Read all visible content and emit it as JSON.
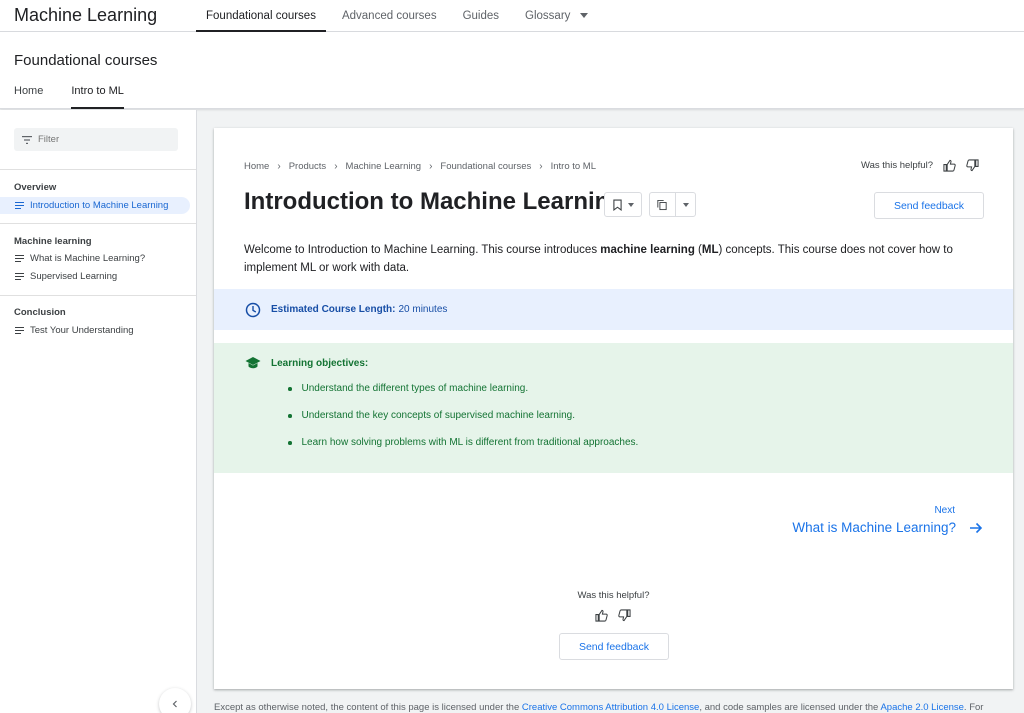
{
  "topbar": {
    "brand": "Machine Learning",
    "tabs": [
      {
        "label": "Foundational courses"
      },
      {
        "label": "Advanced courses"
      },
      {
        "label": "Guides"
      },
      {
        "label": "Glossary"
      }
    ]
  },
  "subheader": {
    "title": "Foundational courses",
    "tabs": [
      {
        "label": "Home"
      },
      {
        "label": "Intro to ML"
      }
    ]
  },
  "sidebar": {
    "filter_placeholder": "Filter",
    "sections": [
      {
        "heading": "Overview",
        "items": [
          {
            "label": "Introduction to Machine Learning"
          }
        ]
      },
      {
        "heading": "Machine learning",
        "items": [
          {
            "label": "What is Machine Learning?"
          },
          {
            "label": "Supervised Learning"
          }
        ]
      },
      {
        "heading": "Conclusion",
        "items": [
          {
            "label": "Test Your Understanding"
          }
        ]
      }
    ]
  },
  "content": {
    "breadcrumb": [
      "Home",
      "Products",
      "Machine Learning",
      "Foundational courses",
      "Intro to ML"
    ],
    "helpful_prompt": "Was this helpful?",
    "title": "Introduction to Machine Learning",
    "send_feedback": "Send feedback",
    "intro": {
      "part1": "Welcome to Introduction to Machine Learning. This course introduces ",
      "bold1": "machine learning",
      "part2": " (",
      "bold2": "ML",
      "part3": ") concepts. This course does not cover how to implement ML or work with data."
    },
    "course_length": {
      "label": "Estimated Course Length:",
      "value": "20 minutes"
    },
    "objectives": {
      "heading": "Learning objectives:",
      "items": [
        "Understand the different types of machine learning.",
        "Understand the key concepts of supervised machine learning.",
        "Learn how solving problems with ML is different from traditional approaches."
      ]
    },
    "next": {
      "label": "Next",
      "title": "What is Machine Learning?"
    }
  },
  "footer": {
    "text1": "Except as otherwise noted, the content of this page is licensed under the ",
    "link1": "Creative Commons Attribution 4.0 License",
    "text2": ", and code samples are licensed under the ",
    "link2": "Apache 2.0 License",
    "text3": ". For"
  },
  "colors": {
    "accent": "#1a73e8",
    "objectives_bg": "#e6f4ea",
    "length_bg": "#e8f0fe"
  }
}
